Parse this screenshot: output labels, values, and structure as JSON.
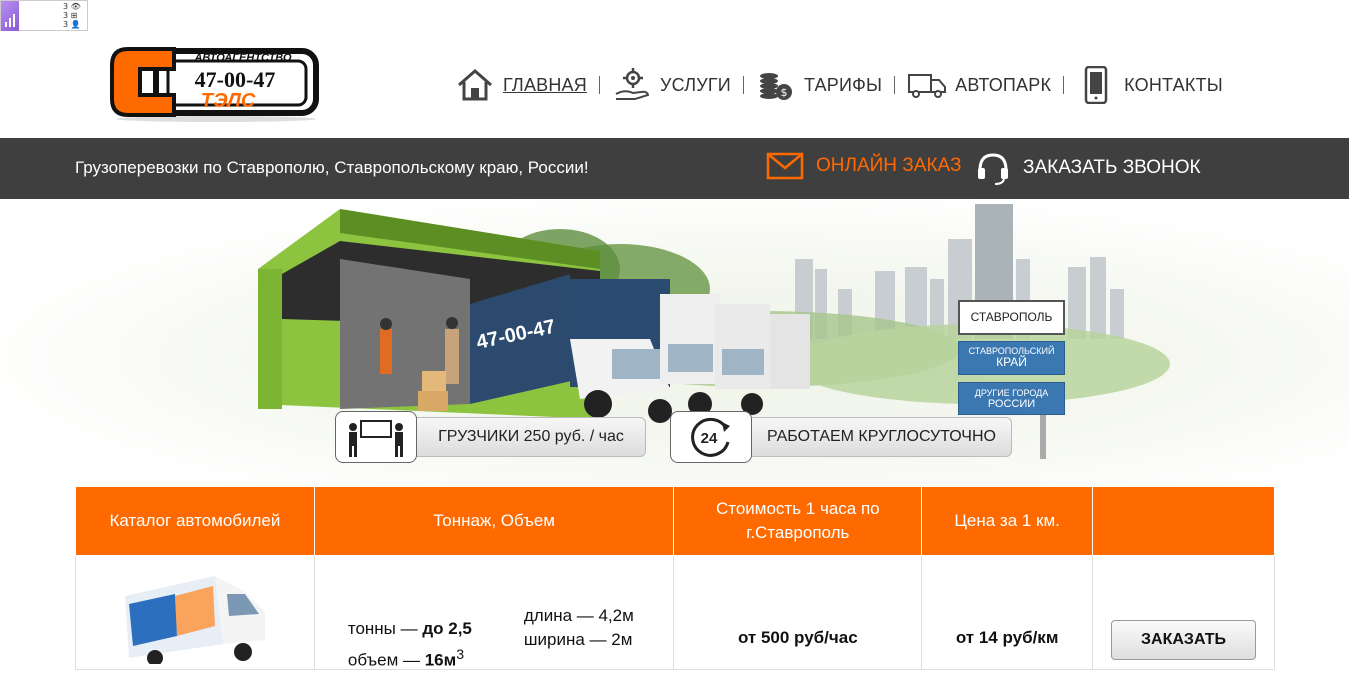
{
  "counter_widget": {
    "lines": [
      "3 👁",
      "3 ⊞",
      "3 👤"
    ]
  },
  "logo": {
    "top_text": "АВТОАГЕНТСТВО",
    "phone": "47-00-47",
    "name": "ТЭЛС",
    "letter": "С"
  },
  "nav": [
    {
      "label": "ГЛАВНАЯ",
      "icon": "home-icon",
      "active": true
    },
    {
      "label": "УСЛУГИ",
      "icon": "gear-hand-icon",
      "active": false
    },
    {
      "label": "ТАРИФЫ",
      "icon": "coins-icon",
      "active": false
    },
    {
      "label": "АВТОПАРК",
      "icon": "truck-icon",
      "active": false
    },
    {
      "label": "КОНТАКТЫ",
      "icon": "phone-icon",
      "active": false
    }
  ],
  "bar": {
    "tagline": "Грузоперевозки по Ставрополю, Ставропольскому краю, России!",
    "online_order": "ОНЛАЙН ЗАКАЗ",
    "callback": "ЗАКАЗАТЬ ЗВОНОК"
  },
  "banner": {
    "truck_phone": "47-00-47",
    "cities": {
      "c1": "СТАВРОПОЛЬ",
      "c2_small": "СТАВРОПОЛЬСКИЙ",
      "c2_big": "КРАЙ",
      "c3_small": "ДРУГИЕ ГОРОДА",
      "c3_big": "РОССИИ"
    },
    "pill1": "ГРУЗЧИКИ 250 руб. / час",
    "pill2": "РАБОТАЕМ КРУГЛОСУТОЧНО",
    "clock_label": "24"
  },
  "table": {
    "headers": [
      "Каталог автомобилей",
      "Тоннаж, Объем",
      "Стоимость 1 часа по г.Ставрополь",
      "Цена за 1 км.",
      ""
    ],
    "row": {
      "tons_label": "тонны — ",
      "tons_value": "до 2,5",
      "volume_label": "объем — ",
      "volume_value": "16м",
      "volume_sup": "3",
      "length": "длина — 4,2м",
      "width": "ширина — 2м",
      "hour_price": "от 500 руб/час",
      "km_price": "от 14 руб/км",
      "order_label": "ЗАКАЗАТЬ"
    }
  },
  "colors": {
    "accent": "#ff6a00",
    "dark_bar": "#3f3f3f",
    "city_blue": "#3b78b2"
  }
}
